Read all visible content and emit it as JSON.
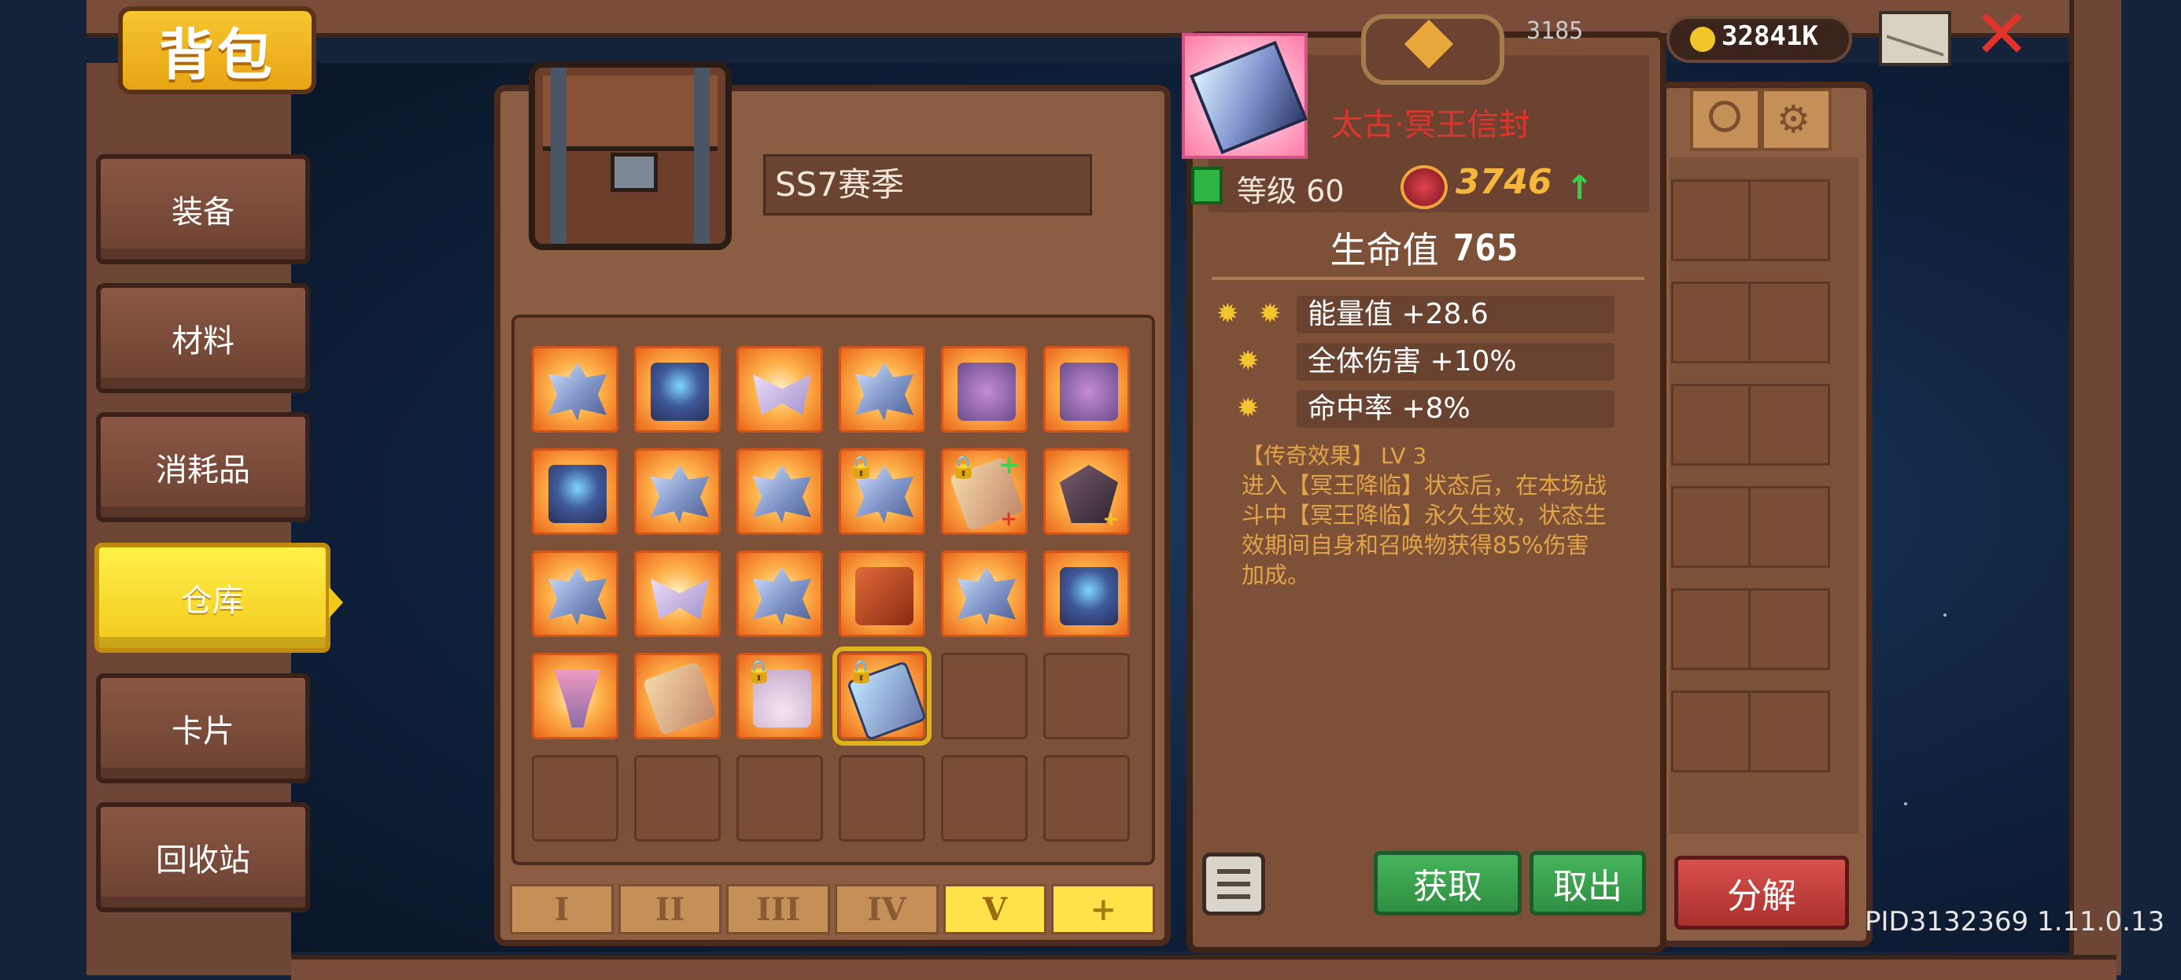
{
  "header": {
    "title": "背包",
    "coins": "32841K",
    "gems_partial": "3185",
    "icons": [
      "mail-icon",
      "close-icon",
      "coin-icon"
    ]
  },
  "sidebar": {
    "items": [
      {
        "label": "装备",
        "active": false
      },
      {
        "label": "材料",
        "active": false
      },
      {
        "label": "消耗品",
        "active": false
      },
      {
        "label": "仓库",
        "active": true
      },
      {
        "label": "卡片",
        "active": false
      },
      {
        "label": "回收站",
        "active": false
      }
    ]
  },
  "storage": {
    "season_name": "SS7赛季",
    "pages": [
      "I",
      "II",
      "III",
      "IV",
      "V",
      "+"
    ],
    "active_page": "V"
  },
  "detail": {
    "item_name": "太古·冥王信封",
    "level_label": "等级 60",
    "power": "3746",
    "hp_label": "生命值",
    "hp_value": "765",
    "stats": [
      {
        "label": "能量值 +28.6",
        "stars": 2
      },
      {
        "label": "全体伤害 +10%",
        "stars": 1
      },
      {
        "label": "命中率 +8%",
        "stars": 1
      }
    ],
    "legend_title": "【传奇效果】 LV 3",
    "legend_text": "进入【冥王降临】状态后，在本场战斗中【冥王降临】永久生效，状态生效期间自身和召唤物获得85%伤害加成。",
    "buttons": {
      "acquire": "获取",
      "take_out": "取出",
      "decompose": "分解"
    }
  },
  "footer": {
    "pid": "PID3132369 1.11.0.13"
  },
  "colors": {
    "accent_yellow": "#ffe24a",
    "item_name_red": "#e0342a",
    "legend_orange": "#e2a447",
    "button_green": "#2f8f42",
    "button_red": "#a9302e"
  }
}
